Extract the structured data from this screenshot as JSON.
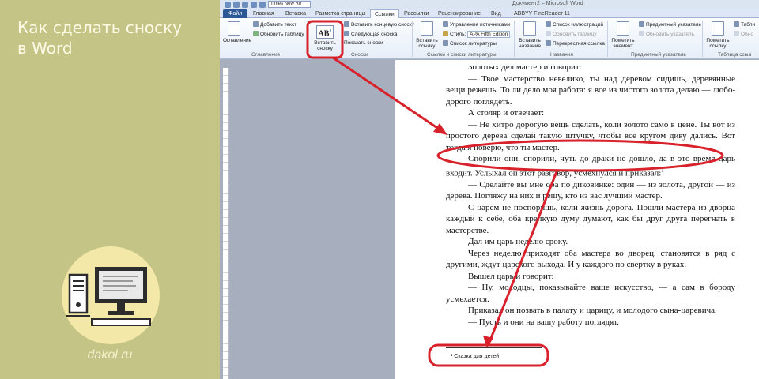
{
  "promo": {
    "title_line1": "Как сделать сноску",
    "title_line2": "в Word",
    "brand": "dakol.ru"
  },
  "titlebar": {
    "font_value": "Times New Ro",
    "doc_title": "Документ2 – Microsoft Word"
  },
  "tabs": [
    "Файл",
    "Главная",
    "Вставка",
    "Разметка страницы",
    "Ссылки",
    "Рассылки",
    "Рецензирование",
    "Вид",
    "ABBYY FineReader 11"
  ],
  "ribbon": {
    "toc_label": "Оглавление",
    "add_text": "Добавить текст",
    "update_table": "Обновить таблицу",
    "group_toc": "Оглавление",
    "insert_footnote_1": "Вставить",
    "insert_footnote_2": "сноску",
    "insert_endnote": "Вставить концевую сноску",
    "next_footnote": "Следующая сноска",
    "show_notes": "Показать сноски",
    "group_footnotes": "Сноски",
    "insert_citation_1": "Вставить",
    "insert_citation_2": "ссылку",
    "manage_sources": "Управление источниками",
    "style_label": "Стиль:",
    "style_value": "APA Fifth Edition",
    "bibliography": "Список литературы",
    "group_citations": "Ссылки и списки литературы",
    "insert_caption_1": "Вставить",
    "insert_caption_2": "название",
    "illustrations_list": "Список иллюстраций",
    "update_table2": "Обновить таблицу",
    "cross_ref": "Перекрестная ссылка",
    "group_captions": "Названия",
    "mark_entry_1": "Пометить",
    "mark_entry_2": "элемент",
    "index_label": "Предметный указатель",
    "update_index": "Обновить указатель",
    "group_index": "Предметный указатель",
    "mark_citation_1": "Пометить",
    "mark_citation_2": "ссылку",
    "table_label": "Табли",
    "update_label": "Обно",
    "group_toa": "Таблица ссыл"
  },
  "document": {
    "paragraphs": [
      "Золотых дел мастер и говорит:",
      "— Твое мастерство невелико, ты над деревом сидишь, деревянные вещи режешь. То ли дело моя работа: я все из чистого золота делаю — любо-дорого поглядеть.",
      "А столяр и отвечает:",
      "— Не хитро дорогую вещь сделать, коли золото само в цене. Ты вот из простого дерева сделай такую штучку, чтобы все кругом диву дались. Вот тогда я поверю, что ты мастер.",
      "Спорили они, спорили, чуть до драки не дошло, да в это время царь входит. Услыхал он этот разговор, усмехнулся и приказал:",
      "— Сделайте вы мне оба по диковинке: один — из золота, другой — из дерева. Погляжу на них и решу, кто из вас лучший мастер.",
      "С царем не поспоришь, коли жизнь дорога. Пошли мастера из дворца каждый к себе, оба крепкую думу думают, как бы друг друга перегнать в мастерстве.",
      "Дал им царь неделю сроку.",
      "Через неделю приходят оба мастера во дворец, становятся в ряд с другими, ждут царского выхода. И у каждого по свертку в руках.",
      "Вышел царь и говорит:",
      "— Ну, молодцы, показывайте ваше искусство, — а сам в бороду усмехается.",
      "Приказал он позвать в палату и царицу, и молодого сына-царевича.",
      "— Пусть и они на вашу работу поглядят."
    ],
    "footnote_mark": "1",
    "footnote_text": "¹ Сказка для детей"
  },
  "colors": {
    "left_bg": "#c3c486",
    "annotation_red": "#d8212b",
    "ribbon_accent": "#2b5797"
  }
}
